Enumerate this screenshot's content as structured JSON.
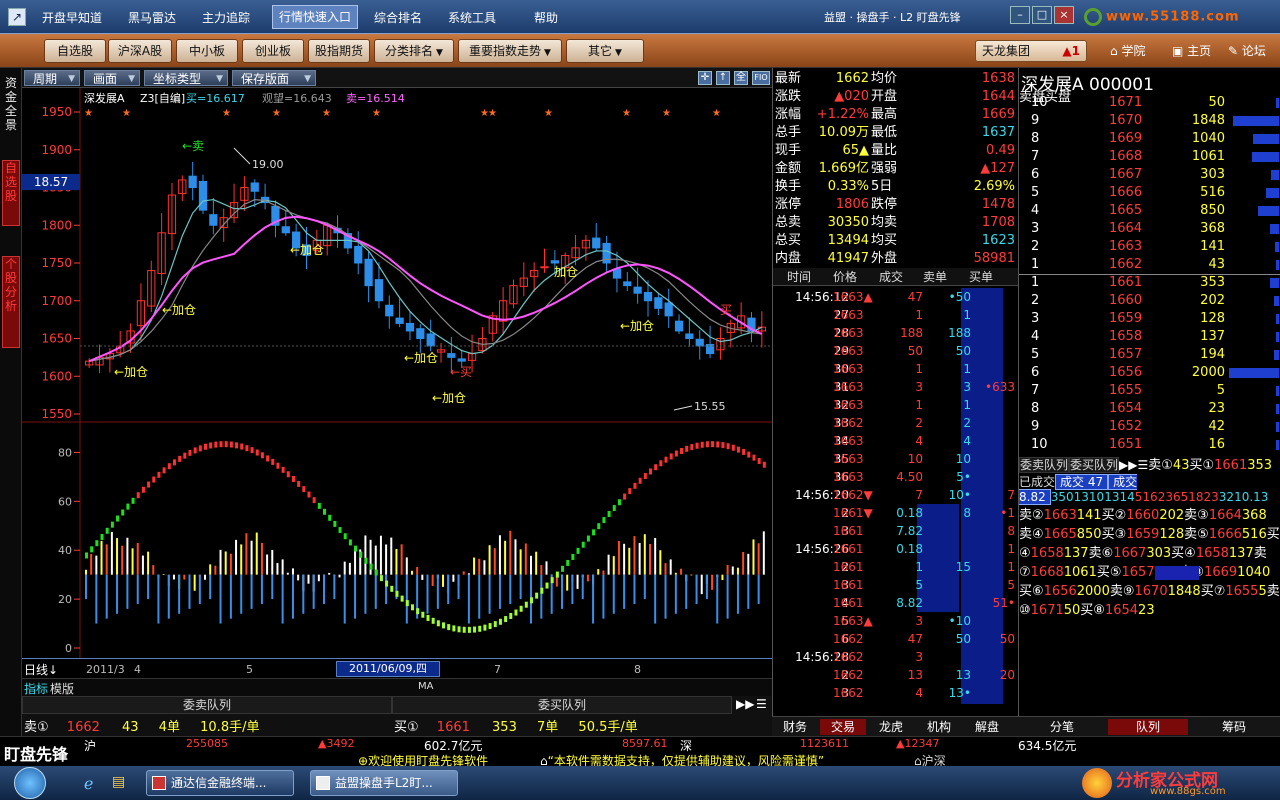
{
  "menu": {
    "items": [
      "开盘早知道",
      "黑马雷达",
      "主力追踪",
      "行情快速入口",
      "综合排名",
      "系统工具",
      "帮助"
    ],
    "title": "益盟 · 操盘手 · L2 盯盘先锋",
    "watermark": "www.55188.com"
  },
  "toolbar": {
    "buttons": [
      "自选股",
      "沪深A股",
      "中小板",
      "创业板",
      "股指期货",
      "分类排名",
      "重要指数走势",
      "其它"
    ],
    "brand": "天龙集团",
    "brand_num": "▲1",
    "links": [
      "学院",
      "主页",
      "论坛"
    ]
  },
  "left_tabs": [
    "资金全景",
    "自选股",
    "个股分析"
  ],
  "chart_header": {
    "buttons": [
      "周期",
      "画面",
      "坐标类型",
      "保存版面"
    ],
    "icon_labels": [
      "✛",
      "↑",
      "全",
      "FIO"
    ],
    "stock": "深发展A",
    "indicator": "Z3[自编]",
    "buy_label": "买=16.617",
    "watch_label": "观望=16.643",
    "sell_label": "卖=16.514",
    "price_tag": "18.57",
    "y_ticks": [
      "1950",
      "1900",
      "1850",
      "1800",
      "1750",
      "1700",
      "1650",
      "1600",
      "1550"
    ],
    "osc_ticks": [
      "80",
      "60",
      "40",
      "20",
      "0"
    ],
    "high_label": "19.00",
    "low_label": "15.55",
    "signals": [
      "←卖",
      "←加仓",
      "←加仓",
      "←加仓",
      "←加仓",
      "←加仓",
      "←买",
      "←加仓",
      "加仓",
      "买"
    ]
  },
  "axis": {
    "labels": [
      "2011/3",
      "4",
      "5",
      "6",
      "7",
      "8"
    ],
    "cursor_date": "2011/06/09,四",
    "period": "日线",
    "tabs": [
      "指标",
      "模版"
    ],
    "ma": "MA"
  },
  "bottom_queue": {
    "sell_hdr": "委卖队列",
    "buy_hdr": "委买队列",
    "sell_row": [
      "卖①",
      "1662",
      "43",
      "4单",
      "10.8手/单"
    ],
    "buy_row": [
      "买①",
      "1661",
      "353",
      "7单",
      "50.5手/单"
    ]
  },
  "quote": {
    "rows": [
      [
        "最新",
        "1662",
        "均价",
        "1638"
      ],
      [
        "涨跌",
        "▲020",
        "开盘",
        "1644"
      ],
      [
        "涨幅",
        "+1.22%",
        "最高",
        "1669"
      ],
      [
        "总手",
        "10.09万",
        "最低",
        "1637"
      ],
      [
        "现手",
        "65▲",
        "量比",
        "0.49"
      ],
      [
        "金额",
        "1.669亿",
        "强弱",
        "▲127"
      ],
      [
        "换手",
        "0.33%",
        "5日",
        "2.69%"
      ],
      [
        "涨停",
        "1806",
        "跌停",
        "1478"
      ],
      [
        "总卖",
        "30350",
        "均卖",
        "1708"
      ],
      [
        "总买",
        "13494",
        "均买",
        "1623"
      ],
      [
        "内盘",
        "41947",
        "外盘",
        "58981"
      ]
    ]
  },
  "ticks": {
    "headers": [
      "时间",
      "价格",
      "成交",
      "卖单",
      "买单"
    ],
    "rows": [
      [
        "14:56:12",
        "1663▲",
        "47",
        "•50",
        ""
      ],
      [
        "27",
        "1663",
        "1",
        "1",
        ""
      ],
      [
        "28",
        "1663",
        "188",
        "188",
        ""
      ],
      [
        "29",
        "1663",
        "50",
        "50",
        ""
      ],
      [
        "30",
        "1663",
        "1",
        "1",
        ""
      ],
      [
        "31",
        "1663",
        "3",
        "3",
        "•633"
      ],
      [
        "32",
        "1663",
        "1",
        "1",
        ""
      ],
      [
        "33",
        "1662",
        "2",
        "2",
        ""
      ],
      [
        "34",
        "1663",
        "4",
        "4",
        ""
      ],
      [
        "35",
        "1663",
        "10",
        "10",
        ""
      ],
      [
        "36",
        "1663",
        "4.50",
        "5•",
        ""
      ],
      [
        "14:56:20",
        "1662▼",
        "7",
        "10•",
        "7"
      ],
      [
        "2",
        "1661▼",
        "0.18",
        "8",
        "•1"
      ],
      [
        "3",
        "1661",
        "7.82",
        "",
        "8"
      ],
      [
        "14:56:26",
        "1661",
        "0.18",
        "",
        "1"
      ],
      [
        "2",
        "1661",
        "1",
        "15",
        "1"
      ],
      [
        "3",
        "1661",
        "5",
        "",
        "5"
      ],
      [
        "4",
        "1661",
        "8.82",
        "",
        "51•"
      ],
      [
        "5",
        "1663▲",
        "3",
        "•10",
        ""
      ],
      [
        "6",
        "1662",
        "47",
        "50",
        "50"
      ],
      [
        "14:56:28",
        "1662",
        "3",
        "",
        ""
      ],
      [
        "2",
        "1662",
        "13",
        "13",
        "20"
      ],
      [
        "3",
        "1662",
        "4",
        "13•",
        ""
      ]
    ],
    "tabs": [
      "财务",
      "交易",
      "龙虎",
      "机构",
      "解盘"
    ]
  },
  "book": {
    "name": "深发展A 000001",
    "side_sell": "卖盘",
    "side_buy": "买盘",
    "sell": [
      [
        "10",
        "1671",
        "50"
      ],
      [
        "9",
        "1670",
        "1848"
      ],
      [
        "8",
        "1669",
        "1040"
      ],
      [
        "7",
        "1668",
        "1061"
      ],
      [
        "6",
        "1667",
        "303"
      ],
      [
        "5",
        "1666",
        "516"
      ],
      [
        "4",
        "1665",
        "850"
      ],
      [
        "3",
        "1664",
        "368"
      ],
      [
        "2",
        "1663",
        "141"
      ],
      [
        "1",
        "1662",
        "43"
      ]
    ],
    "buy": [
      [
        "1",
        "1661",
        "353"
      ],
      [
        "2",
        "1660",
        "202"
      ],
      [
        "3",
        "1659",
        "128"
      ],
      [
        "4",
        "1658",
        "137"
      ],
      [
        "5",
        "1657",
        "194"
      ],
      [
        "6",
        "1656",
        "2000"
      ],
      [
        "7",
        "1655",
        "5"
      ],
      [
        "8",
        "1654",
        "23"
      ],
      [
        "9",
        "1652",
        "42"
      ],
      [
        "10",
        "1651",
        "16"
      ]
    ],
    "queue_sell_hdr": "委卖队列",
    "queue_buy_hdr": "委买队列",
    "q1_sell": [
      "卖①",
      "43"
    ],
    "q1_buy": [
      "买①",
      "1661",
      "353"
    ],
    "deal_left": "成交 47",
    "deal_right": "成交 8.82",
    "done_label": "已成交",
    "queue_misc": [
      "3",
      "50",
      "13",
      "10",
      "13",
      "14",
      "51",
      "6",
      "23",
      "65",
      "182",
      "3",
      "32",
      "1",
      "0.13"
    ],
    "levels": [
      [
        "卖②",
        "1663",
        "141",
        "买②",
        "1660",
        "202"
      ],
      [
        "卖③",
        "1664",
        "368",
        "",
        "",
        " "
      ],
      [
        "卖④",
        "1665",
        "850",
        "买③",
        "1659",
        "128"
      ],
      [
        "卖⑤",
        "1666",
        "516",
        "买④",
        "1658",
        "137"
      ],
      [
        "卖⑥",
        "1667",
        "303",
        "买④",
        "1658",
        "137"
      ],
      [
        "卖⑦",
        "1668",
        "1061",
        "买⑤",
        "1657",
        "194"
      ],
      [
        "卖⑧",
        "1669",
        "1040",
        "买⑥",
        "1656",
        "2000"
      ],
      [
        "卖⑨",
        "1670",
        "1848",
        "买⑦",
        "1655",
        "5"
      ],
      [
        "卖⑩",
        "1671",
        "50",
        "买⑧",
        "1654",
        "23"
      ]
    ],
    "tabs": [
      "分笔",
      "队列",
      "筹码"
    ]
  },
  "status": {
    "logo": "盯盘先锋",
    "sh": "沪",
    "sh_val": "255085",
    "sh_chg": "▲3492",
    "sh_amt": "602.7亿元",
    "sz_val": "8597.61",
    "sz": "深",
    "sz_pts": "1123611",
    "sz_chg": "▲12347",
    "sz_amt": "634.5亿元",
    "ticker": "欢迎使用盯盘先锋软件",
    "ticker2": "“本软件需数据支持，仅提供辅助建议，风险需谨慎”",
    "ticker3": "沪深"
  },
  "taskbar": {
    "tasks": [
      "通达信金融终端...",
      "益盟操盘手L2盯..."
    ],
    "logo": "分析家公式网",
    "logo_url": "www.88gs.com"
  },
  "chart_data": {
    "type": "candlestick",
    "title": "深发展A",
    "ylim": [
      1550,
      1950
    ],
    "x_labels": [
      "2011/3",
      "4",
      "5",
      "6",
      "7",
      "8"
    ],
    "series": [
      {
        "name": "买",
        "values": [
          16.617
        ]
      },
      {
        "name": "观望",
        "values": [
          16.643
        ]
      },
      {
        "name": "卖",
        "values": [
          16.514
        ]
      }
    ]
  }
}
